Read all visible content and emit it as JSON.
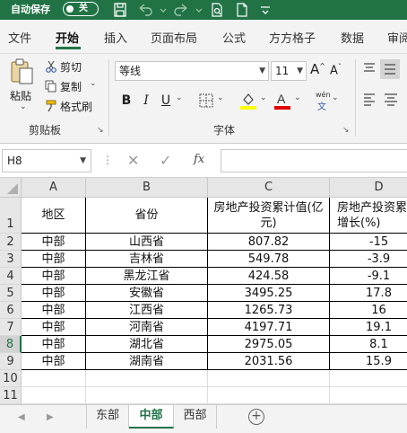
{
  "titlebar": {
    "autosave_label": "自动保存",
    "autosave_state": "关"
  },
  "tabs": [
    "文件",
    "开始",
    "插入",
    "页面布局",
    "公式",
    "方方格子",
    "数据",
    "审阅"
  ],
  "active_tab": "开始",
  "ribbon": {
    "clipboard": {
      "paste": "粘贴",
      "cut": "剪切",
      "copy": "复制",
      "format_painter": "格式刷",
      "group_label": "剪贴板"
    },
    "font": {
      "font_name": "等线",
      "font_size": "11",
      "bold": "B",
      "italic": "I",
      "underline": "U",
      "group_label": "字体",
      "phonetic": "wén"
    }
  },
  "formula_bar": {
    "name_box": "H8",
    "fx": "fx"
  },
  "grid": {
    "columns": [
      "A",
      "B",
      "C",
      "D"
    ],
    "rows": [
      "1",
      "2",
      "3",
      "4",
      "5",
      "6",
      "7",
      "8",
      "9",
      "10",
      "11"
    ],
    "selected_row": "8",
    "header": [
      "地区",
      "省份",
      "房地产投资累计值(亿元)",
      "房地产投资累计增长(%)"
    ],
    "data": [
      [
        "中部",
        "山西省",
        "807.82",
        "-15"
      ],
      [
        "中部",
        "吉林省",
        "549.78",
        "-3.9"
      ],
      [
        "中部",
        "黑龙江省",
        "424.58",
        "-9.1"
      ],
      [
        "中部",
        "安徽省",
        "3495.25",
        "17.8"
      ],
      [
        "中部",
        "江西省",
        "1265.73",
        "16"
      ],
      [
        "中部",
        "河南省",
        "4197.71",
        "19.1"
      ],
      [
        "中部",
        "湖北省",
        "2975.05",
        "8.1"
      ],
      [
        "中部",
        "湖南省",
        "2031.56",
        "15.9"
      ]
    ]
  },
  "sheets": [
    "东部",
    "中部",
    "西部"
  ],
  "active_sheet": "中部",
  "colors": {
    "excel_green": "#217346"
  }
}
